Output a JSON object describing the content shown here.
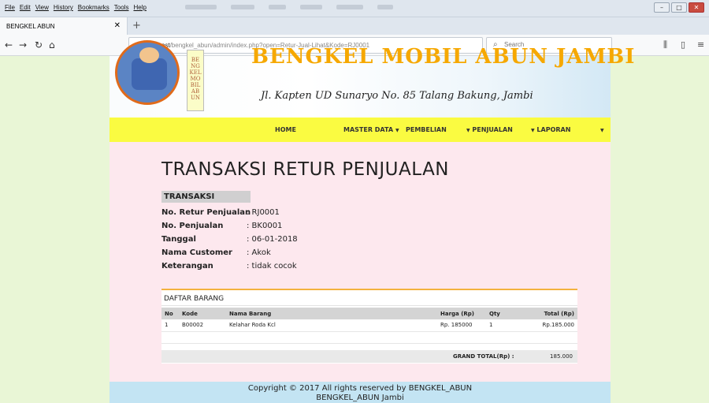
{
  "browser": {
    "menu": [
      "File",
      "Edit",
      "View",
      "History",
      "Bookmarks",
      "Tools",
      "Help"
    ],
    "tab_title": "BENGKEL ABUN",
    "url_host": "localhost",
    "url_path": "/bengkel_abun/admin/index.php?open=Retur-Jual-Lihat&Kode=RJ0001",
    "search_placeholder": "Search",
    "page_actions": "··· ♡ ☆"
  },
  "site": {
    "title": "BENGKEL MOBIL ABUN JAMBI",
    "logo_text": "BENGKEL MOBIL ABUN",
    "address": "Jl. Kapten UD Sunaryo No. 85 Talang Bakung, Jambi",
    "nav": [
      "HOME",
      "MASTER DATA",
      "PEMBELIAN",
      "PENJUALAN",
      "LAPORAN"
    ]
  },
  "page": {
    "title": "TRANSAKSI RETUR PENJUALAN",
    "section": "TRANSAKSI",
    "fields": [
      {
        "label": "No. Retur Penjualan",
        "value": ": RJ0001"
      },
      {
        "label": "No. Penjualan",
        "value": ": BK0001"
      },
      {
        "label": "Tanggal",
        "value": ": 06-01-2018"
      },
      {
        "label": "Nama Customer",
        "value": ": Akok"
      },
      {
        "label": "Keterangan",
        "value": ": tidak cocok"
      }
    ],
    "items_title": "DAFTAR BARANG",
    "columns": [
      "No",
      "Kode",
      "Nama Barang",
      "Harga (Rp)",
      "Qty",
      "Total (Rp)"
    ],
    "rows": [
      {
        "no": "1",
        "kode": "B00002",
        "nama": "Kelahar Roda Kcl",
        "harga": "Rp. 185000",
        "qty": "1",
        "total": "Rp.185.000"
      }
    ],
    "grand_label": "GRAND TOTAL(Rp) :",
    "grand_value": "185.000"
  },
  "footer": {
    "line1": "Copyright © 2017 All rights reserved by BENGKEL_ABUN",
    "line2": "BENGKEL_ABUN Jambi"
  }
}
